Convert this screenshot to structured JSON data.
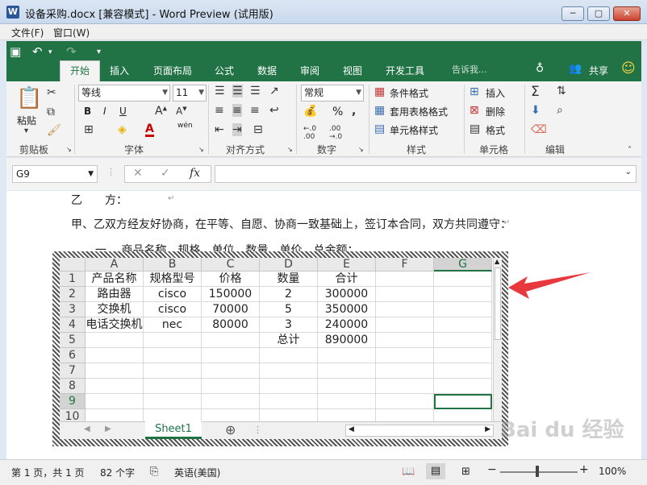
{
  "window": {
    "title": "设备采购.docx [兼容模式] - Word Preview (试用版)",
    "app_icon": "W"
  },
  "menu": {
    "file": "文件(F)",
    "window": "窗口(W)"
  },
  "ribbon": {
    "tabs": [
      "开始",
      "插入",
      "页面布局",
      "公式",
      "数据",
      "审阅",
      "视图",
      "开发工具"
    ],
    "tell_me_placeholder": "告诉我...",
    "share": "共享",
    "clipboard": {
      "paste": "粘贴",
      "label": "剪贴板"
    },
    "font": {
      "name": "等线",
      "size": "11",
      "label": "字体",
      "bold": "B",
      "italic": "I",
      "underline": "U",
      "wen": "wén"
    },
    "alignment": {
      "label": "对齐方式"
    },
    "number": {
      "format": "常规",
      "label": "数字",
      "percent": "%"
    },
    "styles": {
      "conditional": "条件格式",
      "table": "套用表格格式",
      "cell": "单元格样式",
      "label": "样式"
    },
    "cells": {
      "insert": "插入",
      "delete": "删除",
      "format": "格式",
      "label": "单元格"
    },
    "editing": {
      "label": "编辑"
    }
  },
  "formula_bar": {
    "name_box": "G9",
    "formula": ""
  },
  "document": {
    "line1_a": "乙",
    "line1_b": "方：",
    "line2": "甲、乙双方经友好协商，在平等、自愿、协商一致基础上，签订本合同，双方共同遵守：",
    "line3": "一、  商品名称、规格、单位、数量、单价、总金额：",
    "para_mark": "↵"
  },
  "sheet": {
    "columns": [
      "A",
      "B",
      "C",
      "D",
      "E",
      "F",
      "G"
    ],
    "row_numbers": [
      "1",
      "2",
      "3",
      "4",
      "5",
      "6",
      "7",
      "8",
      "9",
      "10"
    ],
    "rows": [
      [
        "产品名称",
        "规格型号",
        "价格",
        "数量",
        "合计",
        "",
        ""
      ],
      [
        "路由器",
        "cisco",
        "150000",
        "2",
        "300000",
        "",
        ""
      ],
      [
        "交换机",
        "cisco",
        "70000",
        "5",
        "350000",
        "",
        ""
      ],
      [
        "电话交换机",
        "nec",
        "80000",
        "3",
        "240000",
        "",
        ""
      ],
      [
        "",
        "",
        "",
        "总计",
        "890000",
        "",
        ""
      ]
    ],
    "active_cell": "G9",
    "sheet_tab": "Sheet1"
  },
  "status_bar": {
    "page": "第 1 页，共 1 页",
    "words": "82 个字",
    "language": "英语(美国)",
    "zoom": "100%"
  },
  "colors": {
    "accent": "#217346",
    "arrow": "#e8383d"
  },
  "watermark": "Bai du 经验"
}
